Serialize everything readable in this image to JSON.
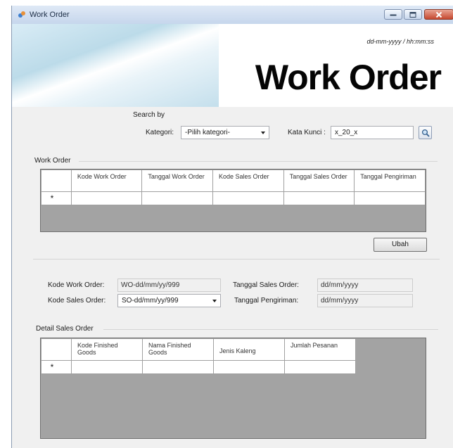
{
  "window": {
    "title": "Work Order"
  },
  "header": {
    "datetime": "dd-mm-yyyy / hh:mm:ss",
    "title": "Work Order"
  },
  "search": {
    "heading": "Search by",
    "kategori_label": "Kategori:",
    "kategori_value": "-Pilih kategori-",
    "kata_kunci_label": "Kata Kunci :",
    "kata_kunci_value": "x_20_x"
  },
  "work_order_grid": {
    "title": "Work Order",
    "columns": [
      "Kode Work Order",
      "Tanggal Work Order",
      "Kode Sales Order",
      "Tanggal Sales Order",
      "Tanggal Pengiriman"
    ],
    "new_row_marker": "*"
  },
  "ubah_button": "Ubah",
  "form": {
    "kode_work_order_label": "Kode Work Order:",
    "kode_work_order_value": "WO-dd/mm/yy/999",
    "kode_sales_order_label": "Kode Sales Order:",
    "kode_sales_order_value": "SO-dd/mm/yy/999",
    "tanggal_sales_order_label": "Tanggal Sales Order:",
    "tanggal_sales_order_value": "dd/mm/yyyy",
    "tanggal_pengiriman_label": "Tanggal Pengiriman:",
    "tanggal_pengiriman_value": "dd/mm/yyyy"
  },
  "detail_grid": {
    "title": "Detail Sales Order",
    "columns": [
      "Kode Finished Goods",
      "Nama Finished Goods",
      "Jenis Kaleng",
      "Jumlah Pesanan"
    ],
    "new_row_marker": "*"
  }
}
